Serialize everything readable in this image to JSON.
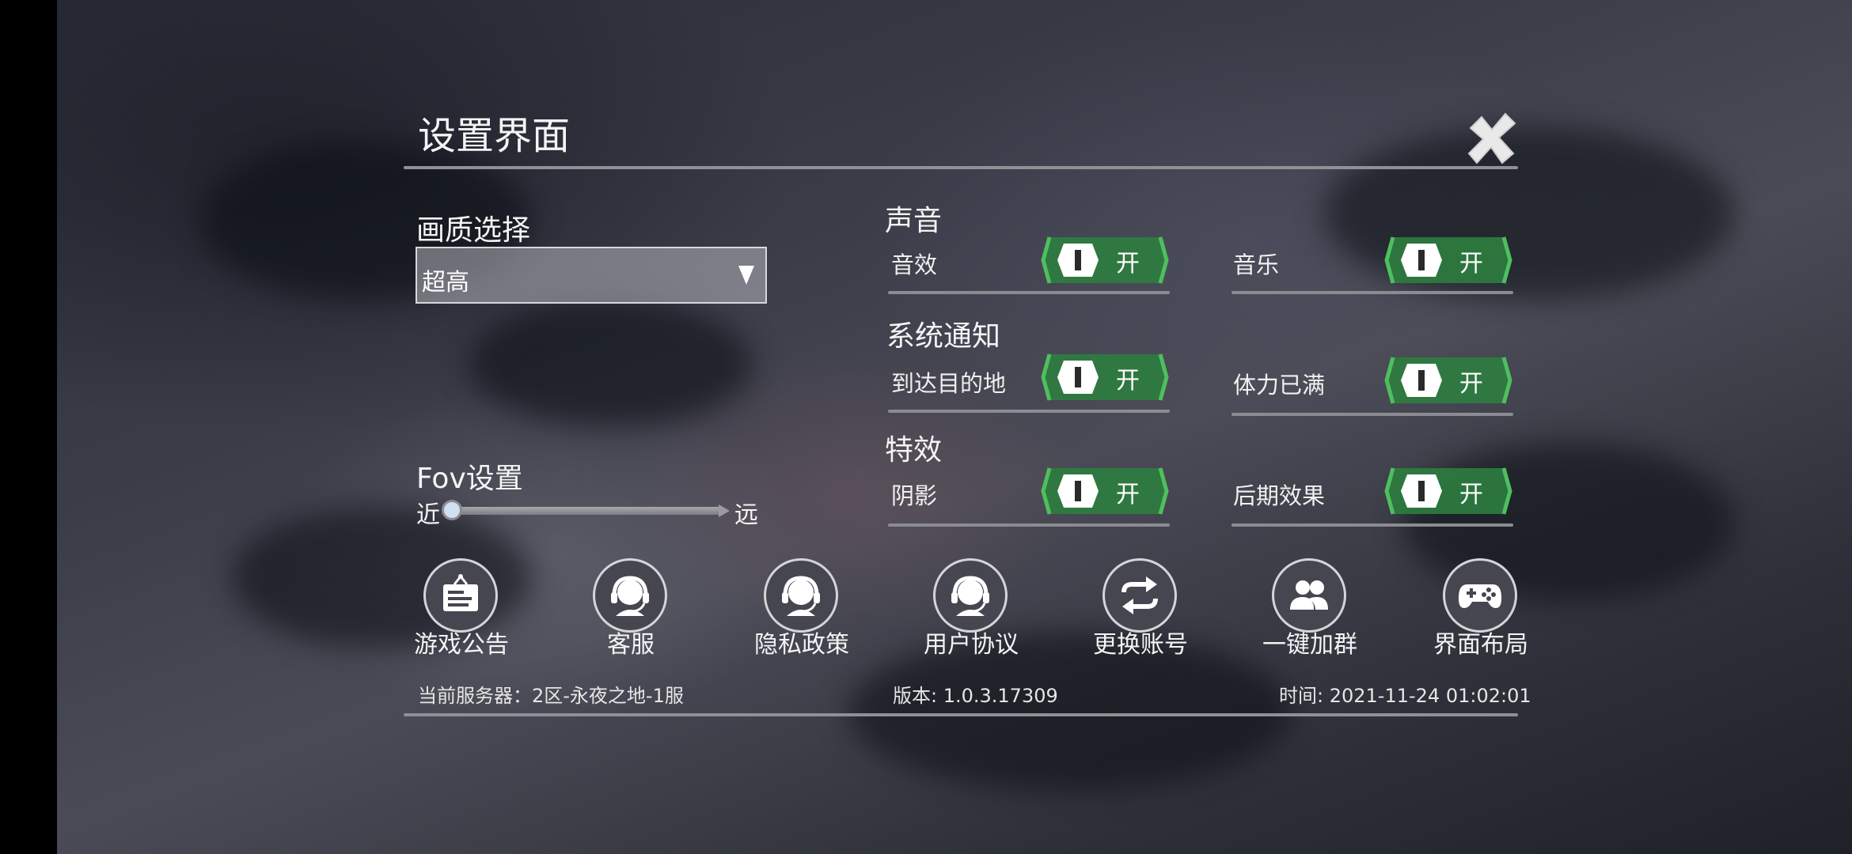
{
  "title": "设置界面",
  "quality": {
    "heading": "画质选择",
    "selected": "超高"
  },
  "fov": {
    "heading": "Fov设置",
    "near_label": "近",
    "far_label": "远",
    "level": 0.0
  },
  "sound": {
    "heading": "声音",
    "items": [
      {
        "label": "音效",
        "state": "开"
      },
      {
        "label": "音乐",
        "state": "开"
      }
    ]
  },
  "notifications": {
    "heading": "系统通知",
    "items": [
      {
        "label": "到达目的地",
        "state": "开"
      },
      {
        "label": "体力已满",
        "state": "开"
      }
    ]
  },
  "effects": {
    "heading": "特效",
    "items": [
      {
        "label": "阴影",
        "state": "开"
      },
      {
        "label": "后期效果",
        "state": "开"
      }
    ]
  },
  "buttons": [
    {
      "label": "游戏公告",
      "icon": "notice-board-icon"
    },
    {
      "label": "客服",
      "icon": "customer-service-icon"
    },
    {
      "label": "隐私政策",
      "icon": "customer-service-icon"
    },
    {
      "label": "用户协议",
      "icon": "customer-service-icon"
    },
    {
      "label": "更换账号",
      "icon": "swap-arrows-icon"
    },
    {
      "label": "一键加群",
      "icon": "group-users-icon"
    },
    {
      "label": "界面布局",
      "icon": "gamepad-icon"
    }
  ],
  "footer": {
    "server": "当前服务器：2区-永夜之地-1服",
    "version": "版本: 1.0.3.17309",
    "time": "时间: 2021-11-24 01:02:01"
  },
  "colors": {
    "toggle_green": "#2e7d3f",
    "toggle_bright": "#4fbf5e",
    "divider": "#8f9095"
  }
}
